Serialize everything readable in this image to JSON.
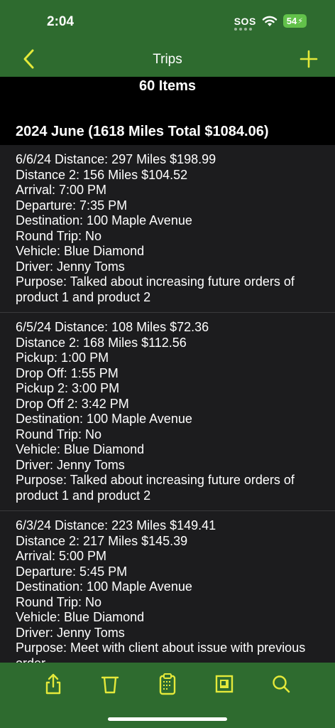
{
  "status_bar": {
    "time": "2:04",
    "sos": "SOS",
    "battery": "54"
  },
  "nav": {
    "title": "Trips",
    "back_icon": "chevron-left-icon",
    "add_icon": "plus-icon"
  },
  "list_header": {
    "count": "60 Items",
    "section_title": "2024 June (1618 Miles Total $1084.06)"
  },
  "trips": [
    {
      "lines": [
        "6/6/24 Distance: 297 Miles $198.99",
        "Distance 2: 156 Miles $104.52",
        "Arrival: 7:00 PM",
        "Departure: 7:35 PM",
        "Destination: 100 Maple Avenue",
        "Round Trip: No",
        "Vehicle: Blue Diamond",
        "Driver: Jenny Toms",
        "Purpose: Talked about increasing future orders of product 1  and product 2"
      ]
    },
    {
      "lines": [
        "6/5/24 Distance: 108 Miles $72.36",
        "Distance 2: 168 Miles $112.56",
        "Pickup: 1:00 PM",
        "Drop Off: 1:55 PM",
        "Pickup 2: 3:00 PM",
        "Drop Off 2: 3:42 PM",
        "Destination: 100 Maple Avenue",
        "Round Trip: No",
        "Vehicle: Blue Diamond",
        "Driver: Jenny Toms",
        "Purpose: Talked about increasing future orders of product 1  and product 2"
      ]
    },
    {
      "lines": [
        "6/3/24 Distance: 223 Miles $149.41",
        "Distance 2: 217 Miles $145.39",
        "Arrival: 5:00 PM",
        "Departure: 5:45 PM",
        "Destination: 100 Maple Avenue",
        "Round Trip: No",
        "Vehicle: Blue Diamond",
        "Driver: Jenny Toms",
        "Purpose: Meet with client about issue with previous order"
      ]
    }
  ],
  "toolbar": {
    "items": [
      "share-icon",
      "trash-icon",
      "clipboard-icon",
      "select-frame-icon",
      "search-icon"
    ]
  },
  "colors": {
    "bar_green": "#2e6b2f",
    "accent_yellow": "#e4e93a",
    "list_bg": "#1c1c1e"
  }
}
